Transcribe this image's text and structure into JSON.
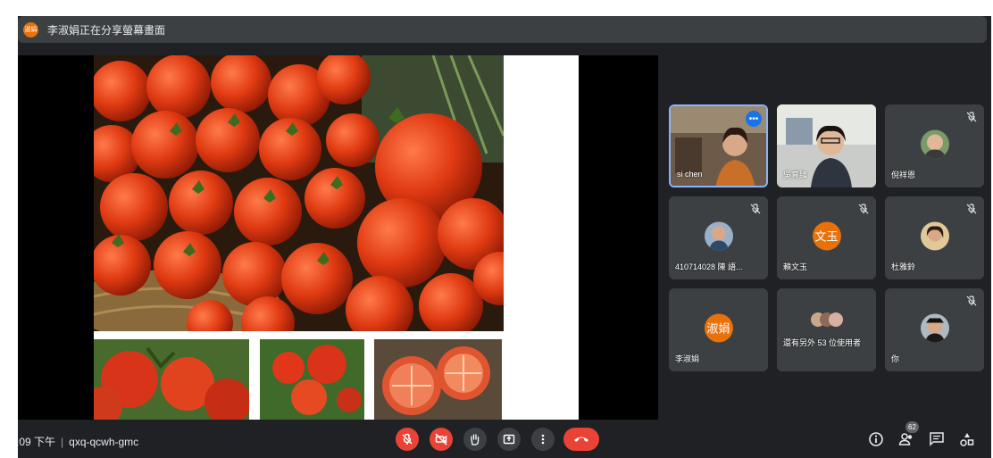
{
  "banner": {
    "avatar_text": "淑娟",
    "text": "李淑娟正在分享螢幕畫面"
  },
  "participants": [
    {
      "name": "si chen",
      "type": "video",
      "muted": false
    },
    {
      "name": "吳育臻",
      "type": "video",
      "muted": false
    },
    {
      "name": "倪祥恩",
      "type": "photo",
      "muted": true
    },
    {
      "name": "410714028 陳 語...",
      "type": "photo",
      "muted": true
    },
    {
      "name": "賴文玉",
      "type": "letter",
      "avatar_text": "文玉",
      "muted": true
    },
    {
      "name": "杜雅鈴",
      "type": "photo",
      "muted": true
    },
    {
      "name": "李淑娟",
      "type": "letter",
      "avatar_text": "淑娟",
      "muted": false
    },
    {
      "name": "還有另外 53 位使用者",
      "type": "group",
      "muted": false
    },
    {
      "name": "你",
      "type": "photo",
      "muted": true
    }
  ],
  "bottom": {
    "time": ":09 下午",
    "meeting_code": "qxq-qcwh-gmc",
    "people_count": "62"
  },
  "colors": {
    "background": "#202124",
    "tile": "#3c4043",
    "accent_red": "#ea4335",
    "avatar_orange": "#e8710a",
    "active_blue": "#8ab4f8"
  },
  "icons": [
    "mic-off-icon",
    "camera-off-icon",
    "raise-hand-icon",
    "present-icon",
    "more-options-icon",
    "hang-up-icon",
    "info-icon",
    "people-icon",
    "chat-icon",
    "activities-icon"
  ]
}
